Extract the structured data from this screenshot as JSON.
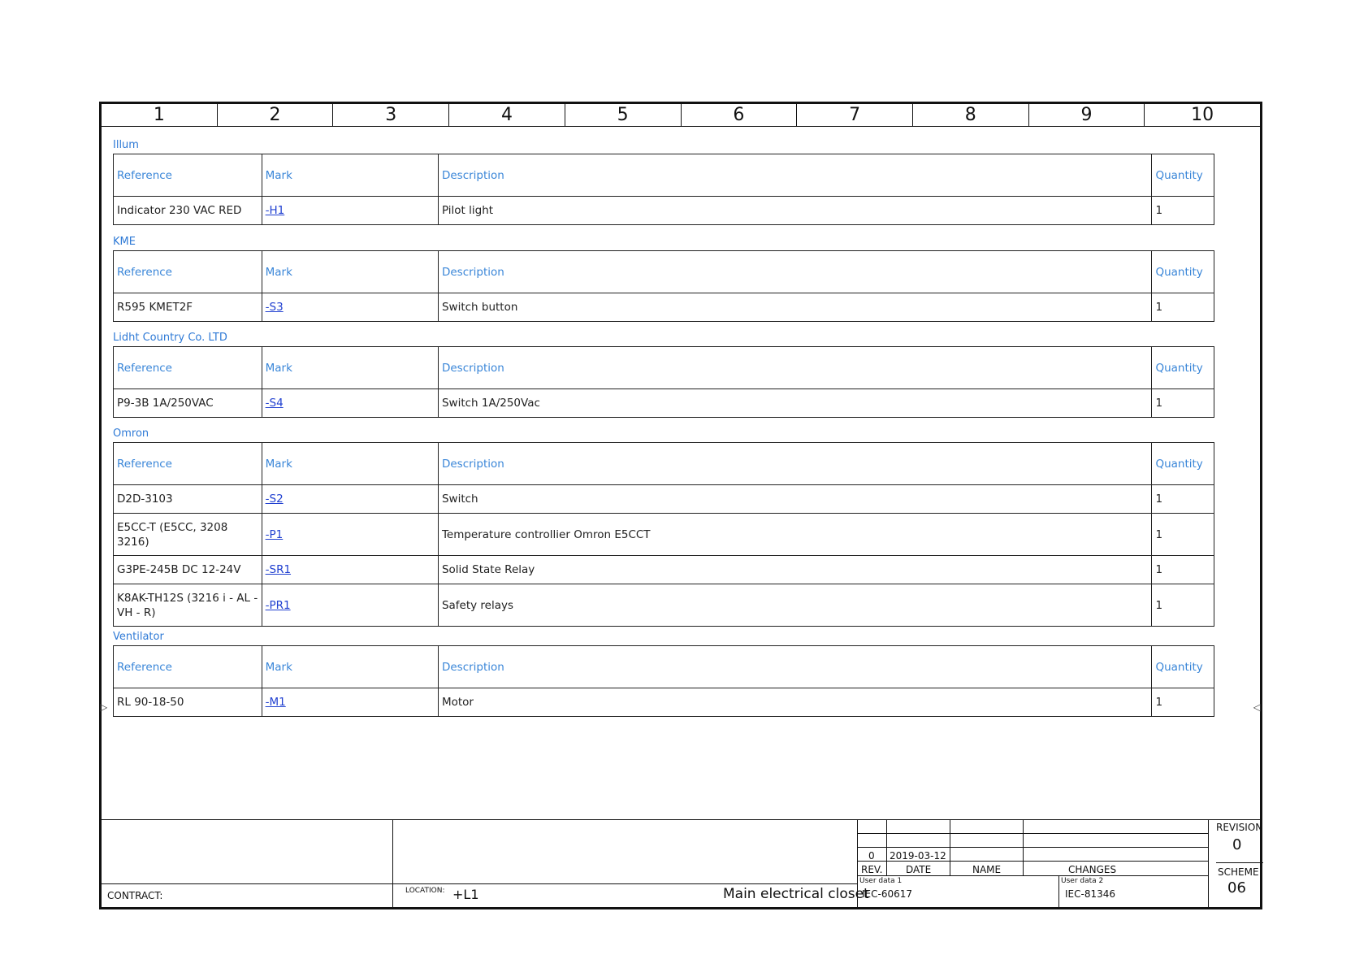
{
  "ruler": [
    "1",
    "2",
    "3",
    "4",
    "5",
    "6",
    "7",
    "8",
    "9",
    "10"
  ],
  "markers": {
    "left": "▷",
    "right": "◁"
  },
  "headers": {
    "reference": "Reference",
    "mark": "Mark",
    "description": "Description",
    "quantity": "Quantity"
  },
  "groups": [
    {
      "title": "Illum",
      "rows": [
        {
          "reference": "Indicator 230 VAC RED",
          "mark": "-H1",
          "description": "Pilot light",
          "quantity": "1"
        }
      ]
    },
    {
      "title": "KME",
      "rows": [
        {
          "reference": "R595 KMET2F",
          "mark": "-S3",
          "description": "Switch button",
          "quantity": "1"
        }
      ]
    },
    {
      "title": "Lidht Country Co. LTD",
      "rows": [
        {
          "reference": "P9-3B 1A/250VAC",
          "mark": "-S4",
          "description": "Switch 1A/250Vac",
          "quantity": "1"
        }
      ]
    },
    {
      "title": "Omron",
      "rows": [
        {
          "reference": "D2D-3103",
          "mark": "-S2",
          "description": "Switch",
          "quantity": "1"
        },
        {
          "reference": "E5CC-T (E5CC, 3208 3216)",
          "mark": "-P1",
          "description": "Temperature controllier Omron E5CCT",
          "quantity": "1"
        },
        {
          "reference": "G3PE-245B DC 12-24V",
          "mark": "-SR1",
          "description": "Solid State Relay",
          "quantity": "1"
        },
        {
          "reference": "K8AK-TH12S (3216 i - AL - VH - R)",
          "mark": "-PR1",
          "description": "Safety relays",
          "quantity": "1"
        }
      ]
    },
    {
      "title": "Ventilator",
      "rows": [
        {
          "reference": "RL 90-18-50",
          "mark": "-M1",
          "description": "Motor",
          "quantity": "1"
        }
      ]
    }
  ],
  "title_block": {
    "contract_label": "CONTRACT:",
    "location_label": "LOCATION:",
    "location_value": "+L1",
    "location_name": "Main electrical closet",
    "rev_value": "0",
    "rev_date": "2019-03-12",
    "rev_label": "REV.",
    "date_label": "DATE",
    "name_label": "NAME",
    "changes_label": "CHANGES",
    "user_data1_label": "User data 1",
    "user_data1_value": "IEC-60617",
    "user_data2_label": "User data 2",
    "user_data2_value": "IEC-81346",
    "revision_label": "REVISION",
    "revision_value": "0",
    "scheme_label": "SCHEME",
    "scheme_value": "06"
  }
}
